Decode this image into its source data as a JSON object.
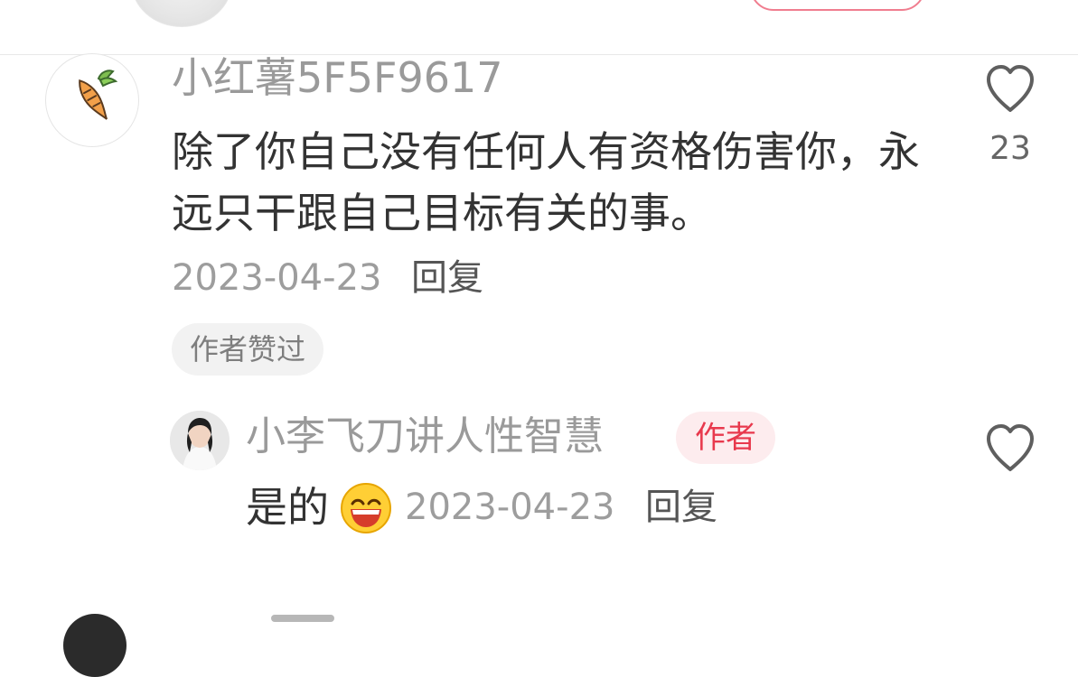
{
  "comment": {
    "username": "小红薯5F5F9617",
    "text": "除了你自己没有任何人有资格伤害你，永远只干跟自己目标有关的事。",
    "date": "2023-04-23",
    "reply_label": "回复",
    "author_liked_label": "作者赞过",
    "like_count": "23",
    "avatar_icon": "carrot-icon"
  },
  "reply": {
    "username": "小李飞刀讲人性智慧",
    "author_badge": "作者",
    "text": "是的",
    "emoji_icon": "grinning-face-icon",
    "date": "2023-04-23",
    "reply_label": "回复"
  },
  "colors": {
    "accent": "#e8394d",
    "badge_bg": "#fdecee",
    "muted_text": "#9a9a9a",
    "body_text": "#333333"
  }
}
